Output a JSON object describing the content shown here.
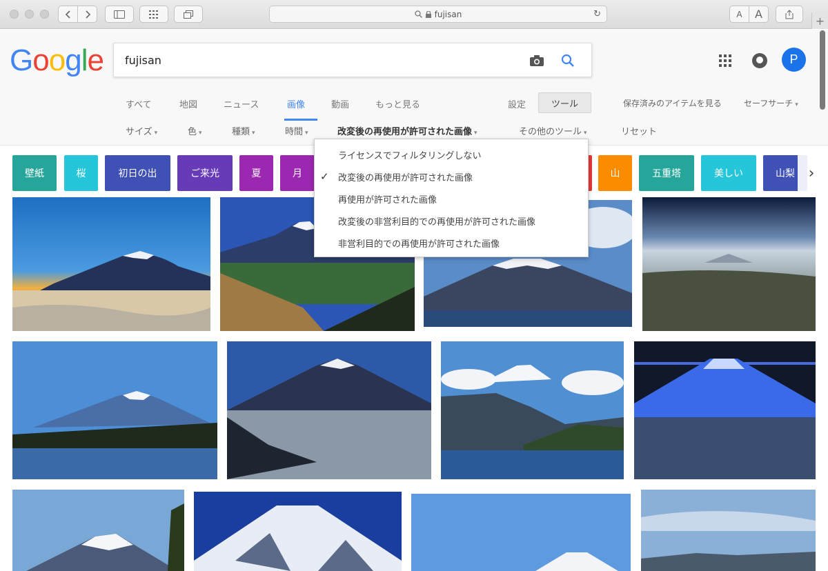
{
  "browser": {
    "url": "fujisan",
    "font_small": "A",
    "font_large": "A",
    "new_tab": "+"
  },
  "logo": [
    "G",
    "o",
    "o",
    "g",
    "l",
    "e"
  ],
  "search": {
    "query": "fujisan"
  },
  "account": {
    "initial": "P"
  },
  "tabs": [
    {
      "label": "すべて"
    },
    {
      "label": "地図"
    },
    {
      "label": "ニュース"
    },
    {
      "label": "画像"
    },
    {
      "label": "動画"
    },
    {
      "label": "もっと見る"
    }
  ],
  "settings_label": "設定",
  "tools_label": "ツール",
  "saved_items_label": "保存済みのアイテムを見る",
  "safesearch_label": "セーフサーチ",
  "filters": [
    {
      "label": "サイズ"
    },
    {
      "label": "色"
    },
    {
      "label": "種類"
    },
    {
      "label": "時間"
    },
    {
      "label": "改変後の再使用が許可された画像"
    },
    {
      "label": "その他のツール"
    },
    {
      "label": "リセット"
    }
  ],
  "caret": "▾",
  "license_menu": {
    "items": [
      {
        "label": "ライセンスでフィルタリングしない",
        "checked": false
      },
      {
        "label": "改変後の再使用が許可された画像",
        "checked": true
      },
      {
        "label": "再使用が許可された画像",
        "checked": false
      },
      {
        "label": "改変後の非営利目的での再使用が許可された画像",
        "checked": false
      },
      {
        "label": "非営利目的での再使用が許可された画像",
        "checked": false
      }
    ],
    "check_glyph": "✓"
  },
  "chips": [
    {
      "label": "壁紙",
      "color": "#26a69a"
    },
    {
      "label": "桜",
      "color": "#26c6da"
    },
    {
      "label": "初日の出",
      "color": "#3f51b5"
    },
    {
      "label": "ご来光",
      "color": "#673ab7"
    },
    {
      "label": "夏",
      "color": "#9c27b0"
    },
    {
      "label": "月",
      "color": "#9c27b0"
    },
    {
      "label": "",
      "color": "#e53935"
    },
    {
      "label": "山",
      "color": "#fb8c00"
    },
    {
      "label": "五重塔",
      "color": "#26a69a"
    },
    {
      "label": "美しい",
      "color": "#26c6da"
    },
    {
      "label": "山梨",
      "color": "#3f51b5"
    }
  ],
  "chip_next_glyph": "›",
  "icons": {
    "camera": "camera-icon",
    "search": "search-icon",
    "apps": "apps-grid-icon",
    "notifications": "notifications-icon"
  }
}
